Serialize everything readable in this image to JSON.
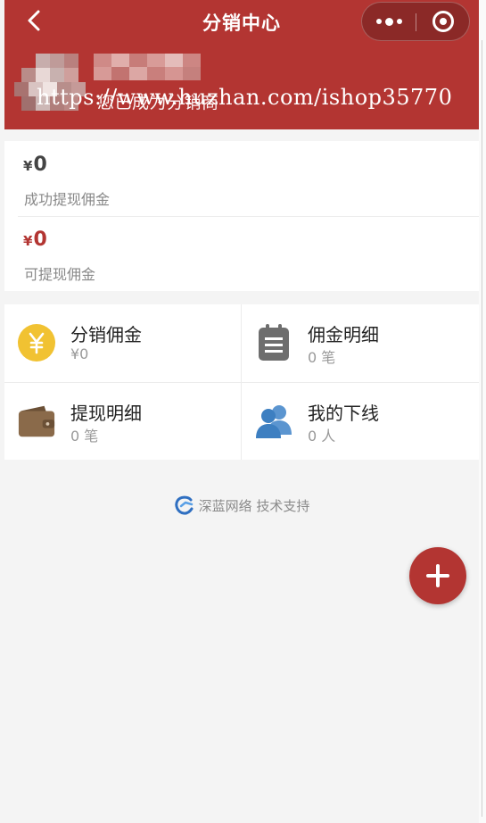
{
  "header": {
    "title": "分销中心",
    "watermark_text": "https://www.huzhan.com/ishop35770",
    "status_text": "您已成为分销商"
  },
  "stats": [
    {
      "currency": "¥",
      "amount": "0",
      "label": "成功提现佣金"
    },
    {
      "currency": "¥",
      "amount": "0",
      "label": "可提现佣金"
    }
  ],
  "grid": [
    {
      "name": "分销佣金",
      "sub": "¥0",
      "icon": "yen-coin-icon"
    },
    {
      "name": "佣金明细",
      "sub": "0 笔",
      "icon": "clipboard-list-icon"
    },
    {
      "name": "提现明细",
      "sub": "0 笔",
      "icon": "wallet-icon"
    },
    {
      "name": "我的下线",
      "sub": "0 人",
      "icon": "users-icon"
    }
  ],
  "footer": {
    "text": "深蓝网络 技术支持"
  },
  "colors": {
    "brand": "#b33532",
    "coin": "#f1c232",
    "wallet": "#8a6a4a",
    "users": "#3d7fc1"
  }
}
